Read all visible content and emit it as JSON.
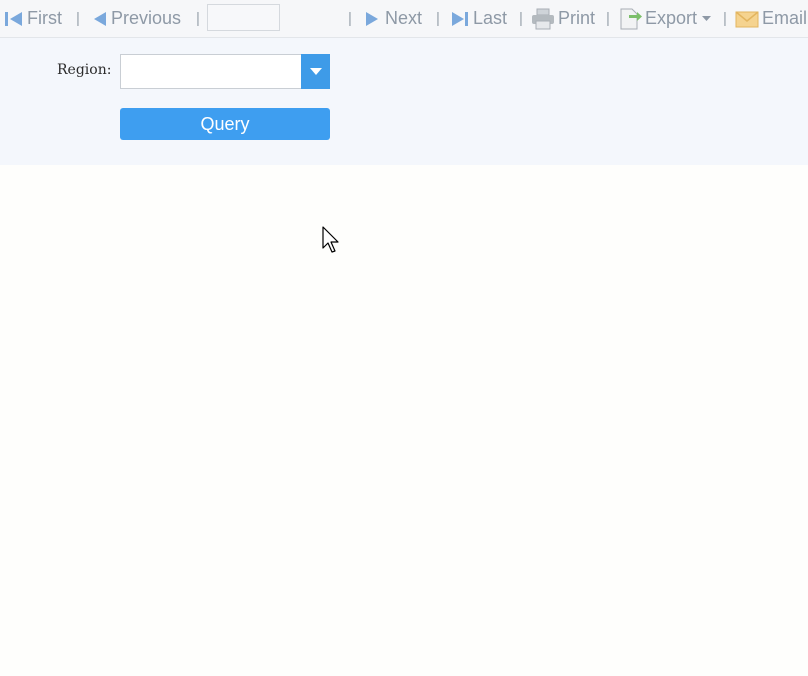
{
  "toolbar": {
    "first_label": "First",
    "previous_label": "Previous",
    "page_input_value": "",
    "next_label": "Next",
    "last_label": "Last",
    "print_label": "Print",
    "export_label": "Export",
    "email_label": "Email",
    "separator": "|"
  },
  "query_form": {
    "region_label": "Region:",
    "region_value": "",
    "query_button_label": "Query"
  },
  "colors": {
    "accent": "#3e9ef0",
    "toolbar_text": "#8e99a6",
    "panel_bg": "#f4f7fc"
  }
}
